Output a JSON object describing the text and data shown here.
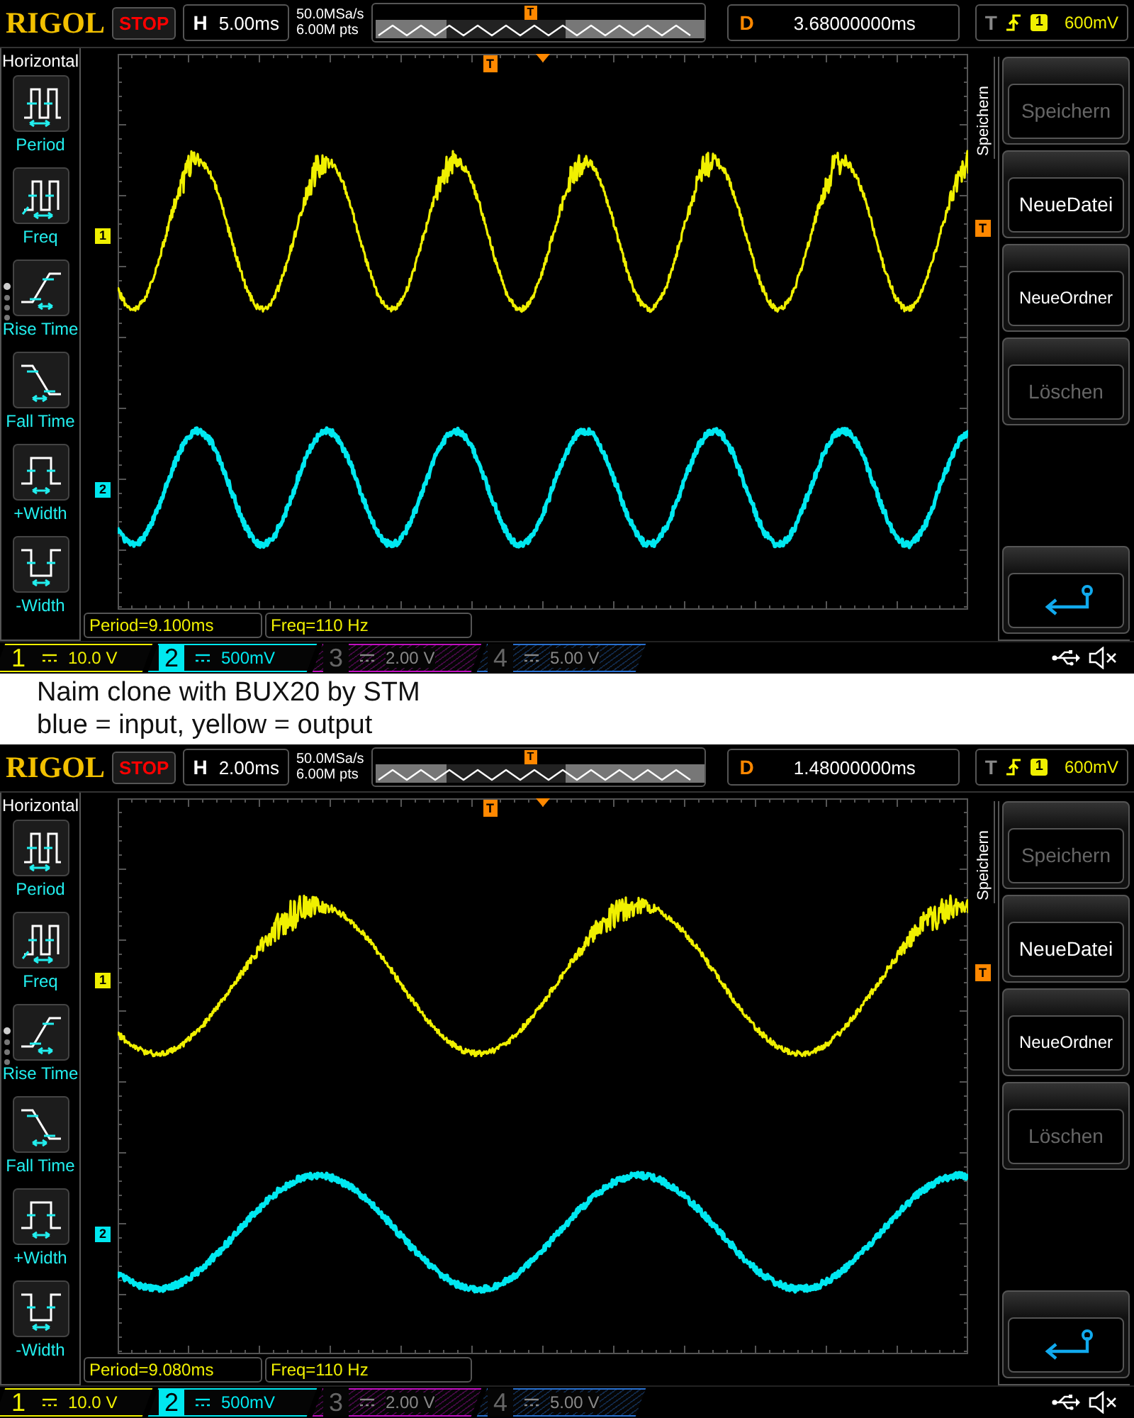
{
  "panels": [
    {
      "kind": "scope",
      "brand": "RIGOL",
      "run_state": "STOP",
      "timebase": {
        "label": "H",
        "value": "5.00ms"
      },
      "sample_rate": "50.0MSa/s",
      "memory_depth": "6.00M pts",
      "memory_marker": "T",
      "delay": {
        "label": "D",
        "value": "3.68000000ms"
      },
      "trigger": {
        "label": "T",
        "source": "1",
        "level": "600mV"
      },
      "left_menu": {
        "title": "Horizontal",
        "items": [
          {
            "kind": "period",
            "label": "Period"
          },
          {
            "kind": "freq",
            "label": "Freq"
          },
          {
            "kind": "rise",
            "label": "Rise Time"
          },
          {
            "kind": "fall",
            "label": "Fall Time"
          },
          {
            "kind": "pwidth",
            "label": "+Width"
          },
          {
            "kind": "nwidth",
            "label": "-Width"
          }
        ]
      },
      "markers": {
        "ch1": "1",
        "ch2": "2",
        "trigger_position": "T",
        "trigger_level": "T"
      },
      "right_menu": {
        "title": "Speichern",
        "items": [
          {
            "kind": "text",
            "label": "Speichern",
            "disabled": true
          },
          {
            "kind": "text",
            "label": "NeueDatei",
            "disabled": false
          },
          {
            "kind": "text",
            "label": "NeueOrdner",
            "disabled": false
          },
          {
            "kind": "text",
            "label": "Löschen",
            "disabled": true
          },
          {
            "kind": "back"
          }
        ]
      },
      "measurements": [
        "Period=9.100ms",
        "Freq=110 Hz"
      ],
      "channels": [
        {
          "label": "1",
          "scale": "10.0 V",
          "on": true,
          "selected": false,
          "color": "#f0f000"
        },
        {
          "label": "2",
          "scale": "500mV",
          "on": true,
          "selected": true,
          "color": "#00e8f0"
        },
        {
          "label": "3",
          "scale": "2.00 V",
          "on": false,
          "selected": false,
          "color": "#c010c0"
        },
        {
          "label": "4",
          "scale": "5.00 V",
          "on": false,
          "selected": false,
          "color": "#2870d0"
        }
      ]
    },
    {
      "kind": "caption",
      "lines": [
        "Naim clone with BUX20 by STM",
        "blue = input, yellow = output"
      ]
    },
    {
      "kind": "scope",
      "brand": "RIGOL",
      "run_state": "STOP",
      "timebase": {
        "label": "H",
        "value": "2.00ms"
      },
      "sample_rate": "50.0MSa/s",
      "memory_depth": "6.00M pts",
      "memory_marker": "T",
      "delay": {
        "label": "D",
        "value": "1.48000000ms"
      },
      "trigger": {
        "label": "T",
        "source": "1",
        "level": "600mV"
      },
      "left_menu": {
        "title": "Horizontal",
        "items": [
          {
            "kind": "period",
            "label": "Period"
          },
          {
            "kind": "freq",
            "label": "Freq"
          },
          {
            "kind": "rise",
            "label": "Rise Time"
          },
          {
            "kind": "fall",
            "label": "Fall Time"
          },
          {
            "kind": "pwidth",
            "label": "+Width"
          },
          {
            "kind": "nwidth",
            "label": "-Width"
          }
        ]
      },
      "markers": {
        "ch1": "1",
        "ch2": "2",
        "trigger_position": "T",
        "trigger_level": "T"
      },
      "right_menu": {
        "title": "Speichern",
        "items": [
          {
            "kind": "text",
            "label": "Speichern",
            "disabled": true
          },
          {
            "kind": "text",
            "label": "NeueDatei",
            "disabled": false
          },
          {
            "kind": "text",
            "label": "NeueOrdner",
            "disabled": false
          },
          {
            "kind": "text",
            "label": "Löschen",
            "disabled": true
          },
          {
            "kind": "back"
          }
        ]
      },
      "measurements": [
        "Period=9.080ms",
        "Freq=110 Hz"
      ],
      "channels": [
        {
          "label": "1",
          "scale": "10.0 V",
          "on": true,
          "selected": false,
          "color": "#f0f000"
        },
        {
          "label": "2",
          "scale": "500mV",
          "on": true,
          "selected": true,
          "color": "#00e8f0"
        },
        {
          "label": "3",
          "scale": "2.00 V",
          "on": false,
          "selected": false,
          "color": "#c010c0"
        },
        {
          "label": "4",
          "scale": "5.00 V",
          "on": false,
          "selected": false,
          "color": "#2870d0"
        }
      ]
    }
  ]
}
